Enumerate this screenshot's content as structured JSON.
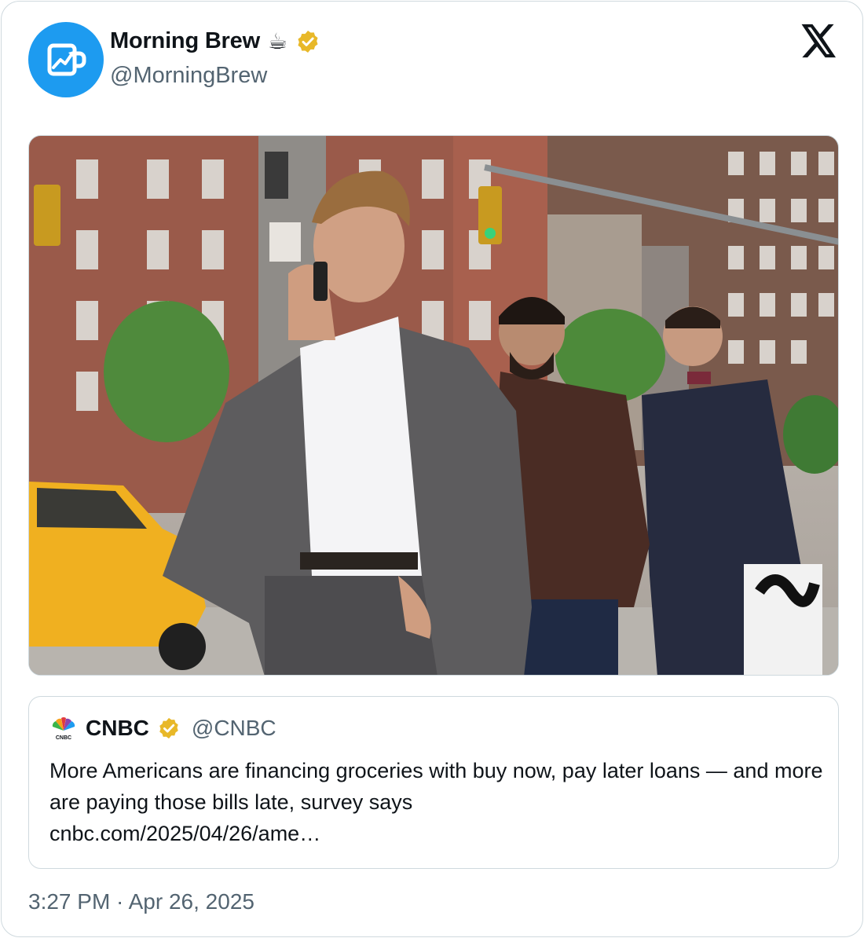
{
  "author": {
    "name": "Morning Brew",
    "emoji": "☕",
    "handle": "@MorningBrew"
  },
  "brand_colors": {
    "accent": "#1d9bf0",
    "verified_gold": "#e8b829",
    "muted_text": "#536471"
  },
  "media": {
    "icon": "photo"
  },
  "quote": {
    "name": "CNBC",
    "handle": "@CNBC",
    "text": "More Americans are financing groceries with buy now, pay later loans — and more are paying those bills late, survey says",
    "link": "cnbc.com/2025/04/26/ame…"
  },
  "timestamp": "3:27 PM · Apr 26, 2025"
}
